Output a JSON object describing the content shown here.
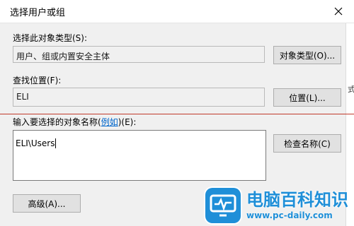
{
  "window": {
    "title": "选择用户或组"
  },
  "object_type": {
    "label": "选择此对象类型(S):",
    "value": "用户、组或内置安全主体",
    "button": "对象类型(O)..."
  },
  "location": {
    "label": "查找位置(F):",
    "value": "ELI",
    "button": "位置(L)..."
  },
  "names": {
    "label_prefix": "输入要选择的对象名称(",
    "label_link": "例如",
    "label_suffix": ")(E):",
    "value": "ELI\\Users",
    "check_button": "检查名称(C)"
  },
  "advanced_button": "高级(A)...",
  "background_window": {
    "edge_char": "式"
  },
  "watermark": {
    "brand": "电脑百科知识",
    "url": "www.pc-daily.com"
  },
  "colors": {
    "dialog_bg": "#f0f0f0",
    "link": "#0066cc",
    "watermark_blue": "#1f8fd8",
    "annotation_line": "#c0392b"
  }
}
